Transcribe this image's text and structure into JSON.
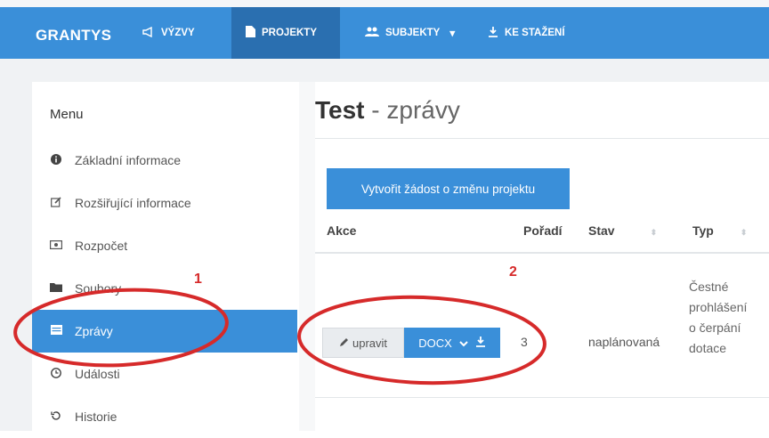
{
  "navbar": {
    "brand": "GRANTYS",
    "items": [
      {
        "label": "VÝZVY",
        "icon": "bullhorn-icon",
        "glyph": "📢"
      },
      {
        "label": "PROJEKTY",
        "icon": "file-icon",
        "glyph": "▮"
      },
      {
        "label": "SUBJEKTY",
        "icon": "users-icon",
        "glyph": "👥",
        "caret": "▾"
      },
      {
        "label": "KE STAŽENÍ",
        "icon": "download-icon",
        "glyph": "⤓"
      }
    ],
    "accent": "#3a8fd9",
    "active_bg": "#2a6fb0"
  },
  "sidebar": {
    "title": "Menu",
    "items": [
      {
        "label": "Základní informace",
        "icon": "info-circle-icon",
        "glyph": "ℹ"
      },
      {
        "label": "Rozšiřující informace",
        "icon": "edit-icon",
        "glyph": "✎"
      },
      {
        "label": "Rozpočet",
        "icon": "money-icon",
        "glyph": "▣"
      },
      {
        "label": "Soubory",
        "icon": "folder-icon",
        "glyph": "■"
      },
      {
        "label": "Zprávy",
        "icon": "list-icon",
        "glyph": "▤"
      },
      {
        "label": "Události",
        "icon": "clock-icon",
        "glyph": "◷"
      },
      {
        "label": "Historie",
        "icon": "history-icon",
        "glyph": "↺"
      }
    ]
  },
  "main": {
    "title_bold": "Test",
    "title_rest": " - zprávy",
    "create_button": "Vytvořit žádost o změnu projektu",
    "columns": [
      "Akce",
      "Pořadí",
      "Stav",
      "Typ"
    ],
    "rows": [
      {
        "edit_label": "upravit",
        "docx_label": "DOCX",
        "order": "3",
        "state": "naplánovaná",
        "type_lines": [
          "Čestné",
          "prohlášení",
          "o čerpání",
          "dotace"
        ]
      }
    ]
  },
  "annotations": {
    "one": "1",
    "two": "2",
    "color": "#d62a2a"
  }
}
